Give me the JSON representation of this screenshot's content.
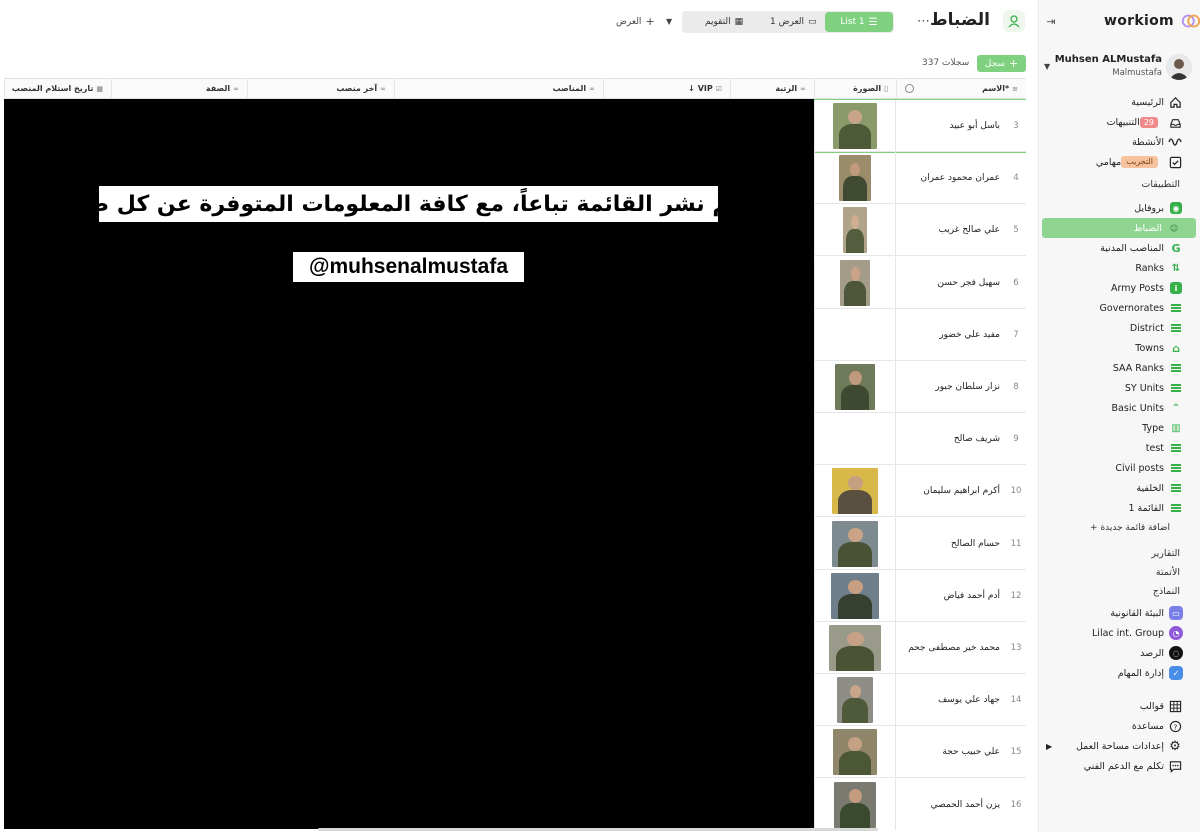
{
  "brand": {
    "name": "workiom"
  },
  "user": {
    "name": "Muhsen ALMustafa",
    "handle": "Malmustafa"
  },
  "sidebar": {
    "main": [
      {
        "label": "الرئيسية",
        "icon": "home-icon"
      },
      {
        "label": "التنبيهات",
        "icon": "bell-icon",
        "badge": "29"
      },
      {
        "label": "الأنشطة",
        "icon": "activity-icon"
      },
      {
        "label": "مهامي",
        "icon": "checkbox-icon",
        "badge": "التجريب"
      }
    ],
    "apps_title": "التطبيقات",
    "apps": [
      {
        "label": "بروفايل"
      },
      {
        "label": "الضباط"
      },
      {
        "label": "المناصب المدنية"
      },
      {
        "label": "Ranks"
      },
      {
        "label": "Army Posts"
      },
      {
        "label": "Governorates"
      },
      {
        "label": "District"
      },
      {
        "label": "Towns"
      },
      {
        "label": "SAA Ranks"
      },
      {
        "label": "SY Units"
      },
      {
        "label": "Basic Units"
      },
      {
        "label": "Type"
      },
      {
        "label": "test"
      },
      {
        "label": "Civil posts"
      },
      {
        "label": "الخلفية"
      },
      {
        "label": "القائمة 1"
      }
    ],
    "add_list": "+ اضافة قائمة جديدة",
    "sections": [
      "التقارير",
      "الأتمتة",
      "النماذج"
    ],
    "workspaces": [
      {
        "label": "البيئة القانونية",
        "color": "#7b7fe8"
      },
      {
        "label": "Lilac int. Group",
        "color": "#8f5ad8"
      },
      {
        "label": "الرصد",
        "color": "#111111"
      },
      {
        "label": "إدارة المهام",
        "color": "#4a8de8"
      }
    ],
    "bottom": [
      {
        "label": "قوالب",
        "icon": "grid-icon"
      },
      {
        "label": "مساعدة",
        "icon": "help-icon"
      },
      {
        "label": "إعدادات مساحة العمل",
        "icon": "gear-icon"
      },
      {
        "label": "تكلم مع الدعم الفني",
        "icon": "chat-icon"
      }
    ]
  },
  "header": {
    "title": "الضباط",
    "views": {
      "active": "List 1",
      "view1": "العرض 1",
      "calendar": "التقويم"
    },
    "add_view": "العرض",
    "add_record": "سجل",
    "record_count": "337 سجلات"
  },
  "table": {
    "columns": [
      "الاسم*",
      "الصورة",
      "الرتبة",
      "VIP",
      "المناصب",
      "آخر منصب",
      "الصفة",
      "تاريخ استلام المنصب"
    ],
    "rows": [
      {
        "num": "3",
        "name": "باسل أبو عبيد",
        "photo": true
      },
      {
        "num": "4",
        "name": "عمران محمود عمران",
        "photo": true
      },
      {
        "num": "5",
        "name": "علي صالح غريب",
        "photo": true
      },
      {
        "num": "6",
        "name": "سهيل فجر حسن",
        "photo": true
      },
      {
        "num": "7",
        "name": "مفيد علي خضور",
        "photo": false
      },
      {
        "num": "8",
        "name": "نزار سلطان جبور",
        "photo": true
      },
      {
        "num": "9",
        "name": "شريف صالح",
        "photo": false
      },
      {
        "num": "10",
        "name": "أكرم ابراهيم سليمان",
        "photo": true
      },
      {
        "num": "11",
        "name": "حسام الصالح",
        "photo": true
      },
      {
        "num": "12",
        "name": "أدم أحمد فياض",
        "photo": true
      },
      {
        "num": "13",
        "name": "محمد خير مصطفى جحم",
        "photo": true
      },
      {
        "num": "14",
        "name": "جهاد علي يوسف",
        "photo": true
      },
      {
        "num": "15",
        "name": "علي حبيب حجة",
        "photo": true
      },
      {
        "num": "16",
        "name": "يزن أحمد الحمصي",
        "photo": true
      }
    ]
  },
  "overlay": {
    "line1": "سيتم نشر القائمة تباعاً، مع كافة المعلومات المتوفرة عن كل ضابط",
    "line2": "@muhsenalmustafa"
  }
}
